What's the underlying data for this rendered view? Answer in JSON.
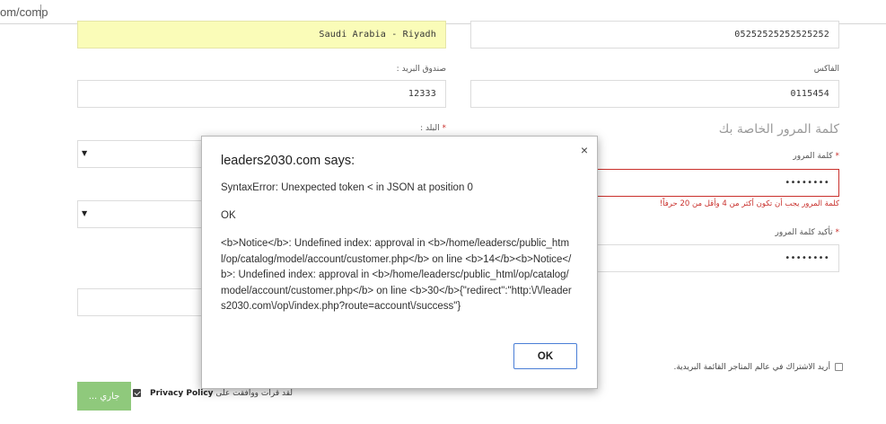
{
  "browser": {
    "url_fragment": "om/comp"
  },
  "form": {
    "city_value": "Saudi Arabia - Riyadh",
    "phone_value": "05252525252525252",
    "postal_label": "صندوق البريد :",
    "postal_value": "12333",
    "fax_label": "الفاكس",
    "fax_value": "0115454",
    "country_label": "البلد :",
    "password_section_heading": "كلمة المرور الخاصة بك",
    "password_label": "كلمة المرور",
    "password_value": "••••••••",
    "password_hint": "كلمة المرور يجب أن تكون أكثر من 4 وأقل من 20 حرفاً!",
    "confirm_label": "تأكيد كلمة المرور",
    "confirm_value": "••••••••",
    "required_mark": "*",
    "select_arrow": "▼",
    "newsletter_text": "أريد الاشتراك في عالم المتاجر القائمة البريدية.",
    "agree_text": "لقد قرأت ووافقت على",
    "privacy_link": "Privacy Policy",
    "submit_label": "جاري ..."
  },
  "dialog": {
    "title": "leaders2030.com says:",
    "line1": "SyntaxError: Unexpected token < in JSON at position 0",
    "line2": "OK",
    "body": "<b>Notice</b>: Undefined index: approval in <b>/home/leadersc/public_html/op/catalog/model/account/customer.php</b> on line <b>14</b><b>Notice</b>: Undefined index: approval in <b>/home/leadersc/public_html/op/catalog/model/account/customer.php</b> on line <b>30</b>{\"redirect\":\"http:\\/\\/leaders2030.com\\/op\\/index.php?route=account\\/success\"}",
    "ok_label": "OK",
    "close_glyph": "×"
  },
  "colors": {
    "error_red": "#c9302c",
    "autofill_yellow": "#fafcb8",
    "submit_green": "#8fc97c",
    "ok_border_blue": "#4a7ed6"
  }
}
